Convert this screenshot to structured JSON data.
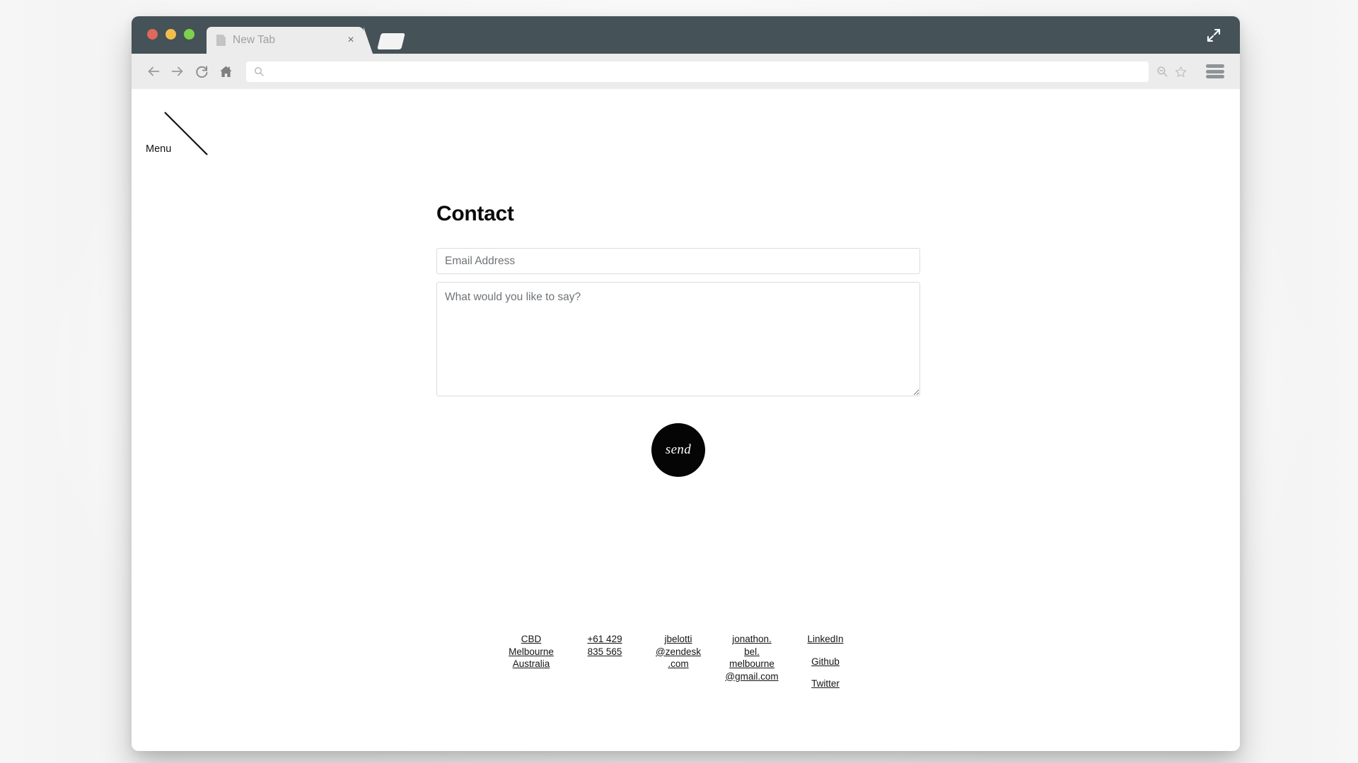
{
  "browser": {
    "title_bar": {
      "traffic_lights": [
        "close-red",
        "minimize-yellow",
        "maximize-green"
      ],
      "expand_icon": "expand-arrows-icon"
    },
    "tab": {
      "title": "New Tab",
      "favicon": "document-icon",
      "close_label": "×"
    },
    "new_tab_button_label": "",
    "toolbar": {
      "back_icon": "arrow-left-icon",
      "forward_icon": "arrow-right-icon",
      "reload_icon": "reload-icon",
      "home_icon": "home-icon",
      "url_value": "",
      "url_placeholder": "",
      "url_search_icon": "search-icon",
      "zoom_out_icon": "zoom-out-icon",
      "bookmark_icon": "star-icon",
      "menu_icon": "hamburger-menu-icon"
    }
  },
  "site": {
    "menu_label": "Menu",
    "heading": "Contact",
    "form": {
      "email_value": "",
      "email_placeholder": "Email Address",
      "message_value": "",
      "message_placeholder": "What would you like to say?",
      "send_label": "send"
    },
    "footer": {
      "address": [
        "CBD",
        "Melbourne",
        "Australia"
      ],
      "phone": [
        "+61 429",
        "835 565"
      ],
      "work_email": [
        "jbelotti",
        "@zendesk",
        ".com"
      ],
      "personal_email": [
        "jonathon.",
        "bel.",
        "melbourne",
        "@gmail.com"
      ],
      "social": [
        "LinkedIn",
        "Github",
        "Twitter"
      ]
    }
  },
  "colors": {
    "titlebar": "#455257",
    "toolbar": "#ececec",
    "tab_active": "#ececec",
    "accent_black": "#050505",
    "light_red": "#e0695c",
    "light_yellow": "#f3bd4e",
    "light_green": "#7ed24b",
    "text_muted": "#6f7377"
  }
}
